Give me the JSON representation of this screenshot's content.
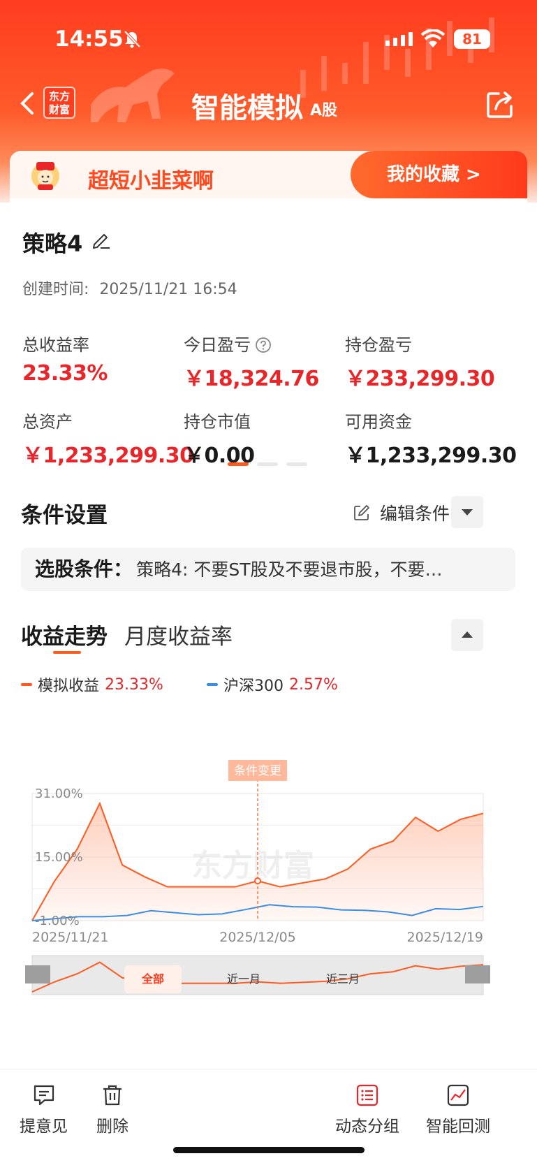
{
  "status_bar": {
    "time": "14:55",
    "battery": "81"
  },
  "nav": {
    "logo_text": "东方财富",
    "title": "智能模拟",
    "subtitle": "A股"
  },
  "profile": {
    "username": "超短小韭菜啊",
    "favorites_button": "我的收藏 >"
  },
  "strategy": {
    "name": "策略4",
    "created_label": "创建时间:",
    "created_value": "2025/11/21 16:54",
    "stats": [
      {
        "label": "总收益率",
        "value": "23.33%",
        "color": "#e8262a"
      },
      {
        "label": "今日盈亏",
        "value": "￥18,324.76",
        "color": "#e8262a",
        "help_icon": "question-circle-icon"
      },
      {
        "label": "持仓盈亏",
        "value": "￥233,299.30",
        "color": "#e8262a"
      },
      {
        "label": "总资产",
        "value": "￥1,233,299.30",
        "color": "#e8262a"
      },
      {
        "label": "持仓市值",
        "value": "￥0.00",
        "color": "#1a1a1a"
      },
      {
        "label": "可用资金",
        "value": "￥1,233,299.30",
        "color": "#1a1a1a"
      }
    ]
  },
  "conditions": {
    "section_title": "条件设置",
    "edit_label": "编辑条件",
    "filter_label": "选股条件：",
    "filter_text": "策略4: 不要ST股及不要退市股，不要…"
  },
  "performance": {
    "tabs": [
      "收益走势",
      "月度收益率"
    ],
    "legend": [
      {
        "name": "模拟收益",
        "value": "23.33%",
        "color": "#ff5a1f"
      },
      {
        "name": "沪深300",
        "value": "2.57%",
        "color": "#3a8ee6"
      }
    ],
    "marker_label": "条件变更",
    "watermark": "东方财富",
    "range_tabs": [
      "全部",
      "近一月",
      "近三月"
    ]
  },
  "chart_data": {
    "type": "area",
    "y_tick_labels": [
      "31.00%",
      "15.00%",
      "-1.00%"
    ],
    "x_tick_labels": [
      "2025/11/21",
      "2025/12/05",
      "2025/12/19"
    ],
    "ylim": [
      -1,
      31
    ],
    "series": [
      {
        "name": "模拟收益",
        "values": [
          -1,
          9,
          17,
          28.5,
          13,
          10,
          7.5,
          7.5,
          7.5,
          7.5,
          9,
          7.5,
          8.5,
          9.5,
          12,
          17,
          19,
          25,
          21.5,
          24.5,
          26
        ]
      },
      {
        "name": "沪深300",
        "values": [
          -1,
          -0.5,
          0,
          0,
          0.3,
          1.5,
          1,
          0.5,
          0.7,
          1.8,
          3,
          2.5,
          2.4,
          1.7,
          1.6,
          1.2,
          0.3,
          2,
          1.8,
          2.57
        ]
      }
    ],
    "marker_index": 10
  },
  "bottom_bar": [
    "提意见",
    "删除",
    "动态分组",
    "智能回测"
  ]
}
